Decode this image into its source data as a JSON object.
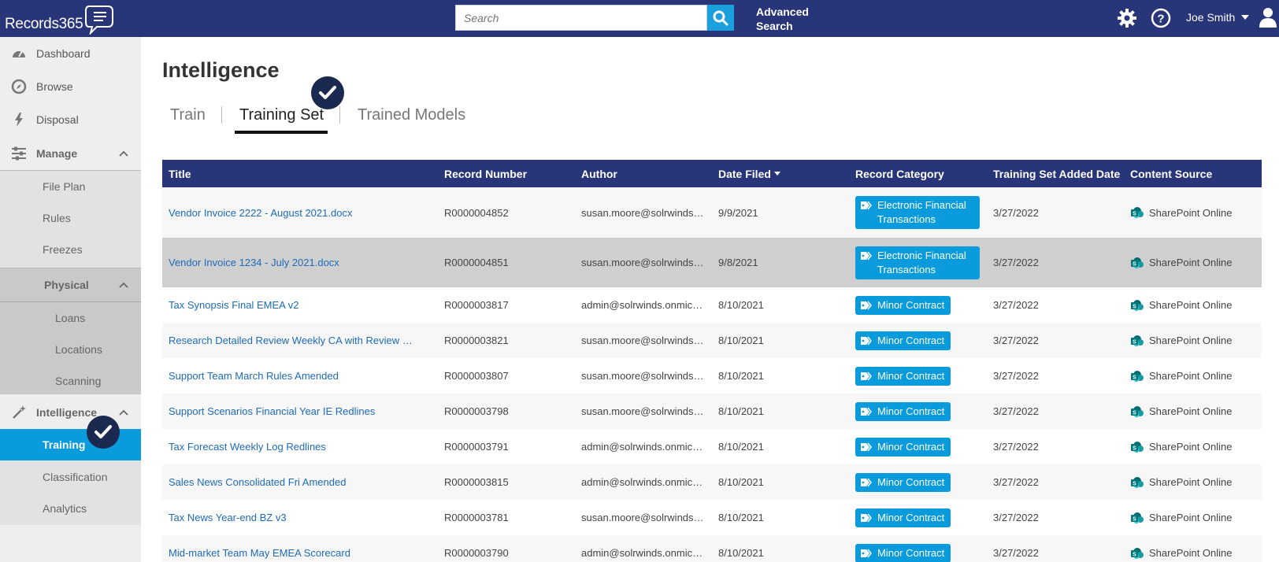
{
  "app": {
    "logo_text": "Records365"
  },
  "header": {
    "search_placeholder": "Search",
    "advanced_search_line1": "Advanced",
    "advanced_search_line2": "Search",
    "user_name": "Joe Smith"
  },
  "sidebar": {
    "dashboard": "Dashboard",
    "browse": "Browse",
    "disposal": "Disposal",
    "manage": "Manage",
    "file_plan": "File Plan",
    "rules": "Rules",
    "freezes": "Freezes",
    "physical": "Physical",
    "loans": "Loans",
    "locations": "Locations",
    "scanning": "Scanning",
    "intelligence": "Intelligence",
    "training": "Training",
    "classification": "Classification",
    "analytics": "Analytics"
  },
  "main": {
    "title": "Intelligence",
    "tabs": [
      "Train",
      "Training Set",
      "Trained Models"
    ]
  },
  "table": {
    "headers": [
      "Title",
      "Record Number",
      "Author",
      "Date Filed",
      "Record Category",
      "Training Set Added Date",
      "Content Source"
    ],
    "rows": [
      {
        "title": "Vendor Invoice 2222 - August 2021.docx",
        "record": "R0000004852",
        "author": "susan.moore@solrwinds.onmicrosoft.com",
        "date": "9/9/2021",
        "category": "Electronic Financial Transactions",
        "added": "3/27/2022",
        "source": "SharePoint Online"
      },
      {
        "title": "Vendor Invoice 1234 - July 2021.docx",
        "record": "R0000004851",
        "author": "susan.moore@solrwinds.onmicrosoft.com",
        "date": "9/8/2021",
        "category": "Electronic Financial Transactions",
        "added": "3/27/2022",
        "source": "SharePoint Online"
      },
      {
        "title": "Tax Synopsis Final EMEA v2",
        "record": "R0000003817",
        "author": "admin@solrwinds.onmicrosoft.com",
        "date": "8/10/2021",
        "category": "Minor Contract",
        "added": "3/27/2022",
        "source": "SharePoint Online"
      },
      {
        "title": "Research Detailed Review Weekly CA with Review Comments",
        "record": "R0000003821",
        "author": "susan.moore@solrwinds.onmicrosoft.com",
        "date": "8/10/2021",
        "category": "Minor Contract",
        "added": "3/27/2022",
        "source": "SharePoint Online"
      },
      {
        "title": "Support Team March Rules Amended",
        "record": "R0000003807",
        "author": "susan.moore@solrwinds.onmicrosoft.com",
        "date": "8/10/2021",
        "category": "Minor Contract",
        "added": "3/27/2022",
        "source": "SharePoint Online"
      },
      {
        "title": "Support Scenarios Financial Year IE Redlines",
        "record": "R0000003798",
        "author": "susan.moore@solrwinds.onmicrosoft.com",
        "date": "8/10/2021",
        "category": "Minor Contract",
        "added": "3/27/2022",
        "source": "SharePoint Online"
      },
      {
        "title": "Tax Forecast Weekly Log Redlines",
        "record": "R0000003791",
        "author": "admin@solrwinds.onmicrosoft.com",
        "date": "8/10/2021",
        "category": "Minor Contract",
        "added": "3/27/2022",
        "source": "SharePoint Online"
      },
      {
        "title": "Sales News Consolidated Fri Amended",
        "record": "R0000003815",
        "author": "admin@solrwinds.onmicrosoft.com",
        "date": "8/10/2021",
        "category": "Minor Contract",
        "added": "3/27/2022",
        "source": "SharePoint Online"
      },
      {
        "title": "Tax News Year-end BZ v3",
        "record": "R0000003781",
        "author": "susan.moore@solrwinds.onmicrosoft.com",
        "date": "8/10/2021",
        "category": "Minor Contract",
        "added": "3/27/2022",
        "source": "SharePoint Online"
      },
      {
        "title": "Mid-market Team May EMEA Scorecard",
        "record": "R0000003790",
        "author": "admin@solrwinds.onmicrosoft.com",
        "date": "8/10/2021",
        "category": "Minor Contract",
        "added": "3/27/2022",
        "source": "SharePoint Online"
      }
    ]
  },
  "colors": {
    "header_bg": "#283578",
    "accent": "#0a9bdc",
    "link": "#1e6bb8"
  }
}
